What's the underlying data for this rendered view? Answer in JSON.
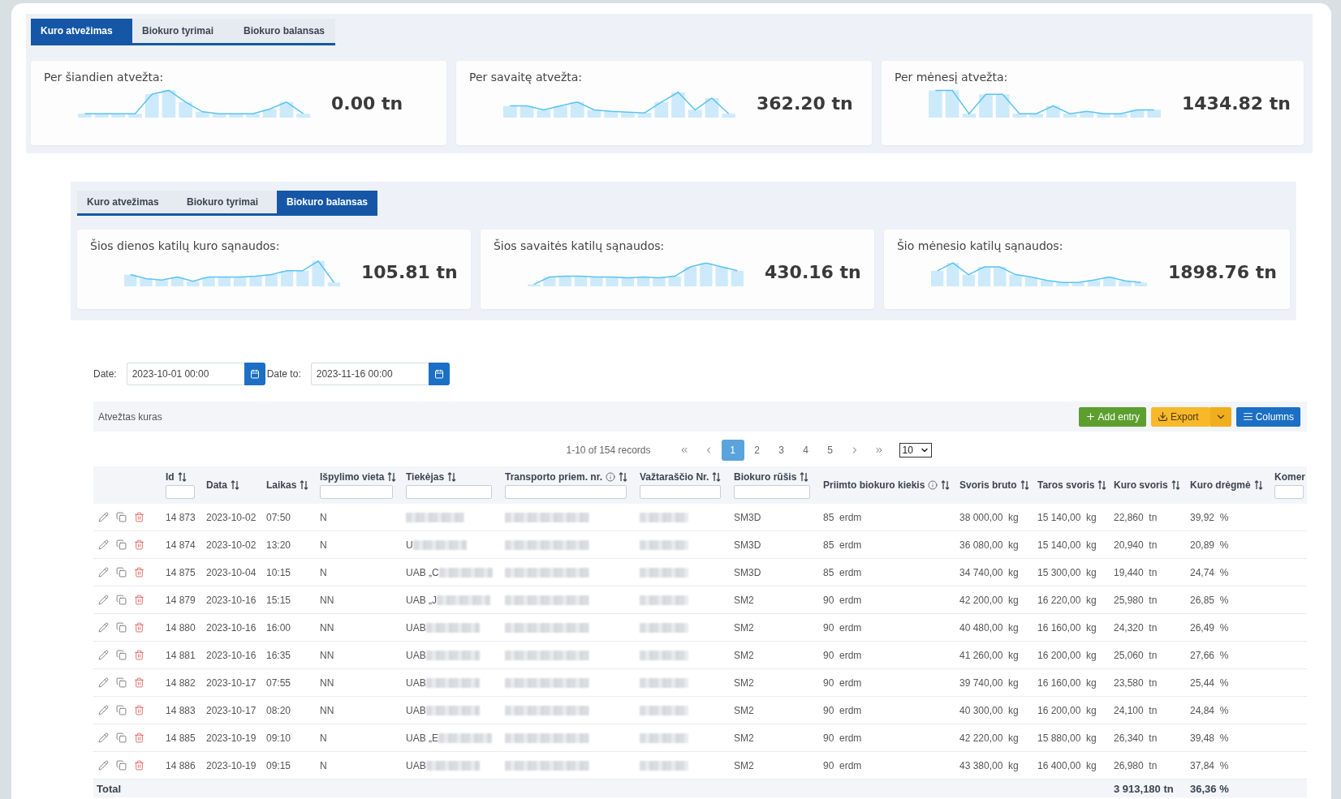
{
  "top_panel": {
    "tabs": [
      {
        "label": "Kuro atvežimas",
        "selected": true
      },
      {
        "label": "Biokuro tyrimai",
        "selected": false
      },
      {
        "label": "Biokuro balansas",
        "selected": false
      }
    ],
    "cards": [
      {
        "title": "Per šiandien atvežta:",
        "value": "0.00 tn"
      },
      {
        "title": "Per savaitę atvežta:",
        "value": "362.20 tn"
      },
      {
        "title": "Per mėnesį atvežta:",
        "value": "1434.82 tn"
      }
    ]
  },
  "second_panel": {
    "tabs": [
      {
        "label": "Kuro atvežimas",
        "selected": false
      },
      {
        "label": "Biokuro tyrimai",
        "selected": false
      },
      {
        "label": "Biokuro balansas",
        "selected": true
      }
    ],
    "cards": [
      {
        "title": "Šios dienos katilų kuro sąnaudos:",
        "value": "105.81 tn"
      },
      {
        "title": "Šios savaitės katilų sąnaudos:",
        "value": "430.16 tn"
      },
      {
        "title": "Šio mėnesio katilų sąnaudos:",
        "value": "1898.76 tn"
      }
    ]
  },
  "filters": [
    {
      "label": "Date:",
      "value": "2023-10-01 00:00"
    },
    {
      "label": "Date to:",
      "value": "2023-11-16 00:00"
    }
  ],
  "table_title": "Atvežtas kuras",
  "buttons": [
    {
      "kind": "add",
      "label": "Add entry"
    },
    {
      "kind": "export",
      "label": "Export"
    },
    {
      "kind": "columns",
      "label": "Columns"
    }
  ],
  "pagination": {
    "summary": "1-10 of 154 records",
    "pages": [
      {
        "label": "1",
        "selected": true
      },
      {
        "label": "2",
        "selected": false
      },
      {
        "label": "3",
        "selected": false
      },
      {
        "label": "4",
        "selected": false
      },
      {
        "label": "5",
        "selected": false
      }
    ],
    "page_size": "10"
  },
  "columns": [
    {
      "label": "Id",
      "sortable": true,
      "filter": true,
      "info": false
    },
    {
      "label": "Data",
      "sortable": true,
      "filter": false,
      "info": false
    },
    {
      "label": "Laikas",
      "sortable": true,
      "filter": false,
      "info": false
    },
    {
      "label": "Išpylimo vieta",
      "sortable": true,
      "filter": true,
      "info": false
    },
    {
      "label": "Tiekėjas",
      "sortable": true,
      "filter": true,
      "info": false
    },
    {
      "label": "Transporto priem. nr.",
      "sortable": true,
      "filter": true,
      "info": true
    },
    {
      "label": "Važtaraščio Nr.",
      "sortable": true,
      "filter": true,
      "info": false
    },
    {
      "label": "Biokuro rūšis",
      "sortable": true,
      "filter": true,
      "info": false
    },
    {
      "label": "Priimto biokuro kiekis",
      "sortable": true,
      "filter": false,
      "info": true
    },
    {
      "label": "Svoris bruto",
      "sortable": true,
      "filter": false,
      "info": false
    },
    {
      "label": "Taros svoris",
      "sortable": true,
      "filter": false,
      "info": false
    },
    {
      "label": "Kuro svoris",
      "sortable": true,
      "filter": false,
      "info": false
    },
    {
      "label": "Kuro drėgmė",
      "sortable": true,
      "filter": false,
      "info": false
    },
    {
      "label": "Komer",
      "sortable": false,
      "filter": true,
      "info": false
    }
  ],
  "rows": [
    {
      "id": "14 873",
      "date": "2023-10-02",
      "time": "07:50",
      "site": "N",
      "supplier": {
        "blurred": true
      },
      "transport": {
        "blurred": true
      },
      "waybill": {
        "blurred": true
      },
      "type": "SM3D",
      "quantity": "85  erdm",
      "gross": "38 000,00  kg",
      "tare": "15 140,00  kg",
      "net": "22,860  tn",
      "moisture": "39,92  %"
    },
    {
      "id": "14 874",
      "date": "2023-10-02",
      "time": "13:20",
      "site": "N",
      "supplier": {
        "text": "U",
        "blurred": true
      },
      "transport": {
        "blurred": true
      },
      "waybill": {
        "blurred": true
      },
      "type": "SM3D",
      "quantity": "85  erdm",
      "gross": "36 080,00  kg",
      "tare": "15 140,00  kg",
      "net": "20,940  tn",
      "moisture": "20,89  %"
    },
    {
      "id": "14 875",
      "date": "2023-10-04",
      "time": "10:15",
      "site": "N",
      "supplier": {
        "text": "UAB „C",
        "blurred": true
      },
      "transport": {
        "blurred": true
      },
      "waybill": {
        "blurred": true
      },
      "type": "SM3D",
      "quantity": "85  erdm",
      "gross": "34 740,00  kg",
      "tare": "15 300,00  kg",
      "net": "19,440  tn",
      "moisture": "24,74  %"
    },
    {
      "id": "14 879",
      "date": "2023-10-16",
      "time": "15:15",
      "site": "NN",
      "supplier": {
        "text": "UAB „J",
        "blurred": true
      },
      "transport": {
        "blurred": true
      },
      "waybill": {
        "blurred": true
      },
      "type": "SM2",
      "quantity": "90  erdm",
      "gross": "42 200,00  kg",
      "tare": "16 220,00  kg",
      "net": "25,980  tn",
      "moisture": "26,85  %"
    },
    {
      "id": "14 880",
      "date": "2023-10-16",
      "time": "16:00",
      "site": "NN",
      "supplier": {
        "text": "UAB",
        "blurred": true
      },
      "transport": {
        "blurred": true
      },
      "waybill": {
        "blurred": true
      },
      "type": "SM2",
      "quantity": "90  erdm",
      "gross": "40 480,00  kg",
      "tare": "16 160,00  kg",
      "net": "24,320  tn",
      "moisture": "26,49  %"
    },
    {
      "id": "14 881",
      "date": "2023-10-16",
      "time": "16:35",
      "site": "NN",
      "supplier": {
        "text": "UAB",
        "blurred": true
      },
      "transport": {
        "blurred": true
      },
      "waybill": {
        "blurred": true
      },
      "type": "SM2",
      "quantity": "90  erdm",
      "gross": "41 260,00  kg",
      "tare": "16 200,00  kg",
      "net": "25,060  tn",
      "moisture": "27,66  %"
    },
    {
      "id": "14 882",
      "date": "2023-10-17",
      "time": "07:55",
      "site": "NN",
      "supplier": {
        "text": "UAB",
        "blurred": true
      },
      "transport": {
        "blurred": true
      },
      "waybill": {
        "blurred": true
      },
      "type": "SM2",
      "quantity": "90  erdm",
      "gross": "39 740,00  kg",
      "tare": "16 160,00  kg",
      "net": "23,580  tn",
      "moisture": "25,44  %"
    },
    {
      "id": "14 883",
      "date": "2023-10-17",
      "time": "08:20",
      "site": "NN",
      "supplier": {
        "text": "UAB",
        "blurred": true
      },
      "transport": {
        "blurred": true
      },
      "waybill": {
        "blurred": true
      },
      "type": "SM2",
      "quantity": "90  erdm",
      "gross": "40 300,00  kg",
      "tare": "16 200,00  kg",
      "net": "24,100  tn",
      "moisture": "24,84  %"
    },
    {
      "id": "14 885",
      "date": "2023-10-19",
      "time": "09:10",
      "site": "N",
      "supplier": {
        "text": "UAB „E",
        "blurred": true
      },
      "transport": {
        "blurred": true
      },
      "waybill": {
        "blurred": true
      },
      "type": "SM2",
      "quantity": "90  erdm",
      "gross": "42 220,00  kg",
      "tare": "15 880,00  kg",
      "net": "26,340  tn",
      "moisture": "39,48  %"
    },
    {
      "id": "14 886",
      "date": "2023-10-19",
      "time": "09:15",
      "site": "N",
      "supplier": {
        "text": "UAB",
        "blurred": true
      },
      "transport": {
        "blurred": true
      },
      "waybill": {
        "blurred": true
      },
      "type": "SM2",
      "quantity": "90  erdm",
      "gross": "43 380,00  kg",
      "tare": "16 400,00  kg",
      "net": "26,980  tn",
      "moisture": "37,84  %"
    }
  ],
  "total": {
    "label": "Total",
    "net": "3 913,180 tn",
    "moisture": "36,36 %"
  }
}
